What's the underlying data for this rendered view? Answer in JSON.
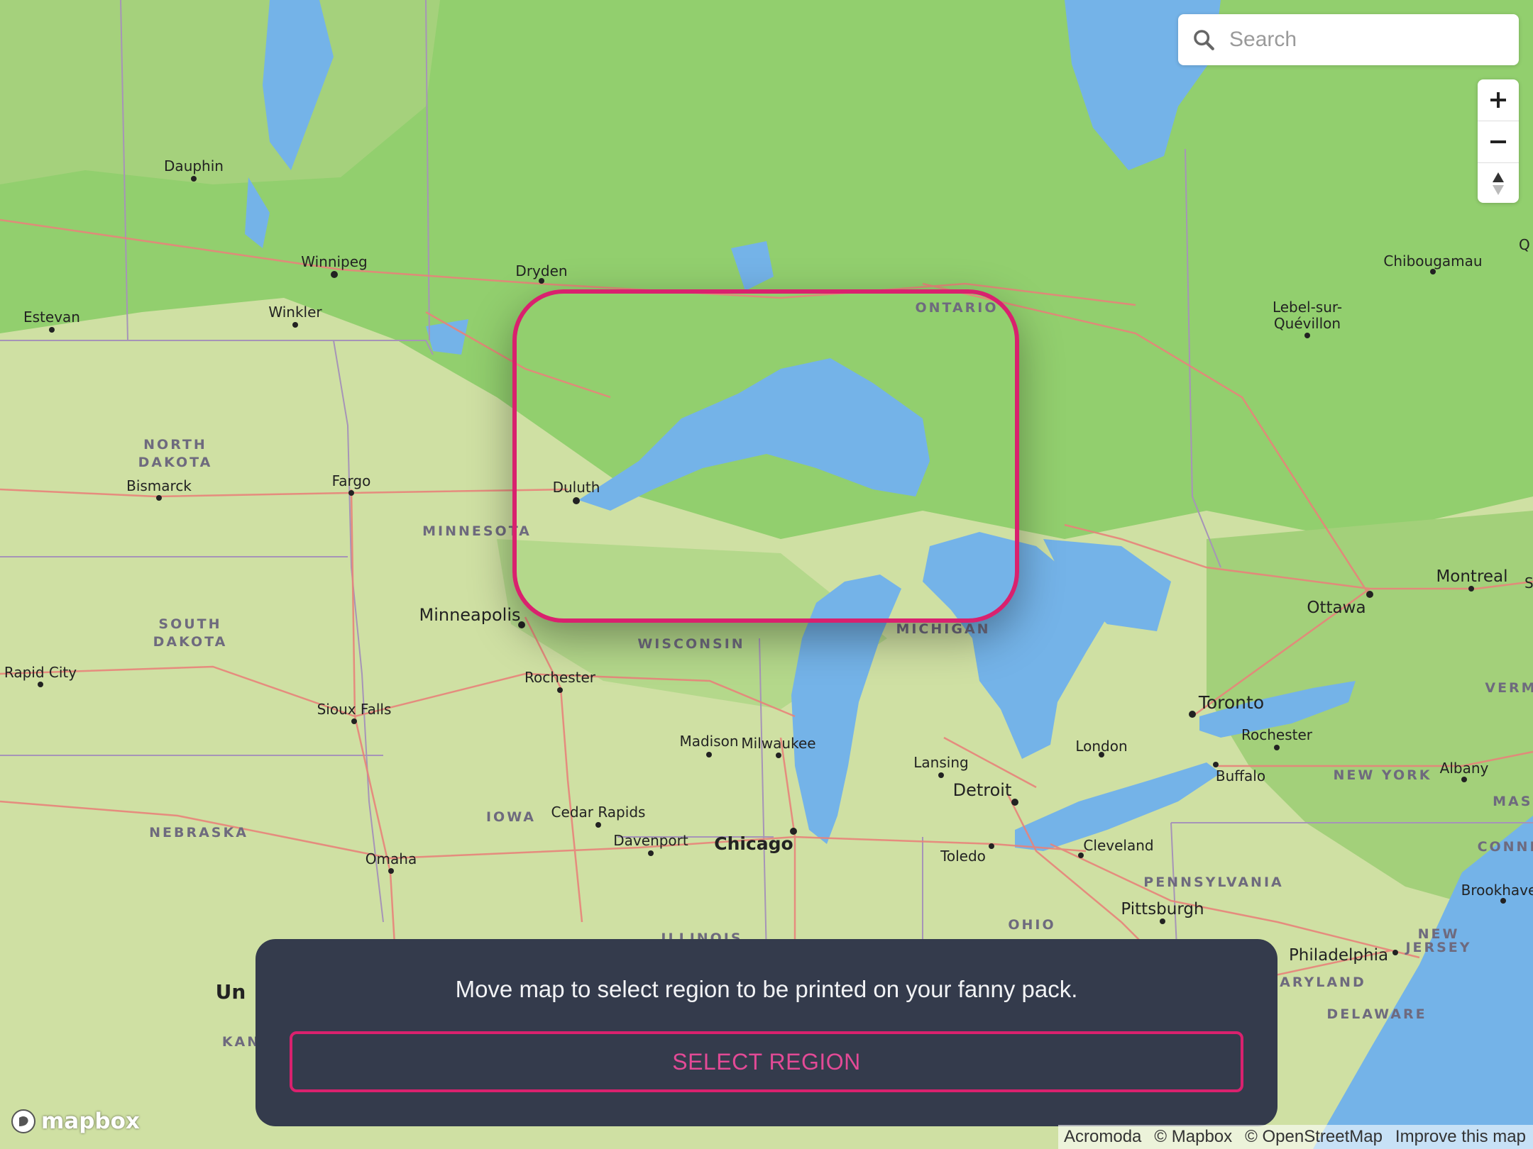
{
  "search": {
    "placeholder": "Search"
  },
  "zoom_controls": {
    "zoom_in": "+",
    "zoom_out": "−",
    "compass": "▲"
  },
  "map_labels": {
    "cities": [
      "Dauphin",
      "Winnipeg",
      "Estevan",
      "Winkler",
      "Dryden",
      "Bismarck",
      "Fargo",
      "Duluth",
      "Minneapolis",
      "Rochester",
      "Rapid City",
      "Sioux Falls",
      "Madison",
      "Milwaukee",
      "Cedar Rapids",
      "Davenport",
      "Chicago",
      "Omaha",
      "Lansing",
      "Detroit",
      "Toledo",
      "London",
      "Toronto",
      "Rochester",
      "Buffalo",
      "Cleveland",
      "Pittsburgh",
      "Ottawa",
      "Montreal",
      "Chibougamau",
      "Lebel-sur-",
      "Quévillon",
      "Albany",
      "Philadelphia",
      "Brookhave"
    ],
    "regions": [
      "ONTARIO",
      "NORTH",
      "DAKOTA",
      "MINNESOTA",
      "SOUTH",
      "DAKOTA",
      "WISCONSIN",
      "MICHIGAN",
      "IOWA",
      "NEBRASKA",
      "NEW YORK",
      "PENNSYLVANIA",
      "OHIO",
      "MARYLAND",
      "DELAWARE",
      "NEW",
      "JERSEY",
      "VERMON",
      "MASSA",
      "CONNECTI",
      "ILLINOIS",
      "KAN",
      "Un",
      "Sh",
      "Q"
    ]
  },
  "panel": {
    "message": "Move map to select region to be printed on your fanny pack.",
    "button_label": "SELECT REGION"
  },
  "brand": {
    "logo_text": "mapbox"
  },
  "attribution": [
    "Acromoda",
    "© Mapbox",
    "© OpenStreetMap",
    "Improve this map"
  ],
  "colors": {
    "accent": "#d9216e",
    "panel_bg": "#343b4c",
    "water": "#74b3e8",
    "forest": "#8fcf6d",
    "farmland": "#d7e2a3"
  }
}
